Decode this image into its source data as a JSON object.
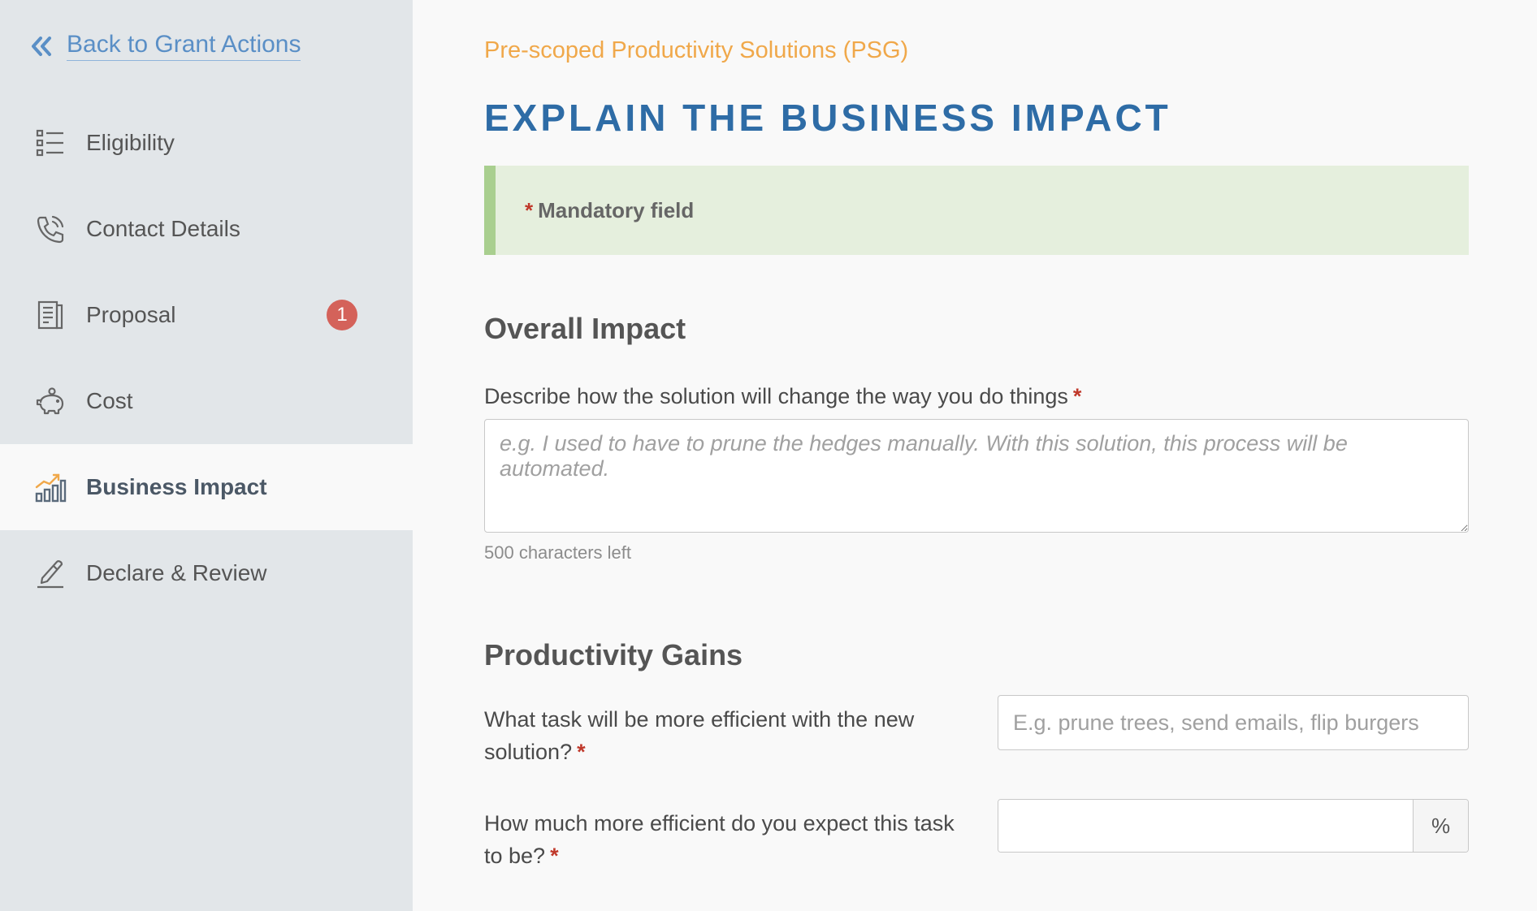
{
  "sidebar": {
    "back_label": "Back to Grant Actions",
    "items": [
      {
        "label": "Eligibility",
        "icon": "list-icon"
      },
      {
        "label": "Contact Details",
        "icon": "phone-icon"
      },
      {
        "label": "Proposal",
        "icon": "document-icon",
        "badge": "1"
      },
      {
        "label": "Cost",
        "icon": "piggy-bank-icon"
      },
      {
        "label": "Business Impact",
        "icon": "bar-chart-icon",
        "active": true
      },
      {
        "label": "Declare & Review",
        "icon": "pen-icon"
      }
    ]
  },
  "header": {
    "subtitle": "Pre-scoped Productivity Solutions (PSG)",
    "title": "EXPLAIN THE BUSINESS IMPACT"
  },
  "notice": {
    "asterisk": "*",
    "text": "Mandatory field"
  },
  "overall_impact": {
    "title": "Overall Impact",
    "question": "Describe how the solution will change the way you do things",
    "required_mark": "*",
    "placeholder": "e.g. I used to have to prune the hedges manually. With this solution, this process will be automated.",
    "value": "",
    "chars_left": "500 characters left"
  },
  "productivity_gains": {
    "title": "Productivity Gains",
    "task_question_line1": "What task will be more efficient with the new",
    "task_question_line2": "solution?",
    "task_placeholder": "E.g. prune trees, send emails, flip burgers",
    "task_value": "",
    "efficiency_question_line1": "How much more efficient do you expect this task",
    "efficiency_question_line2": "to be?",
    "efficiency_value": "",
    "efficiency_unit": "%",
    "required_mark": "*"
  },
  "colors": {
    "accent_blue": "#2e6ca6",
    "subtitle_orange": "#f0a84a",
    "badge_red": "#d4625a",
    "notice_green": "#e5efdd"
  }
}
